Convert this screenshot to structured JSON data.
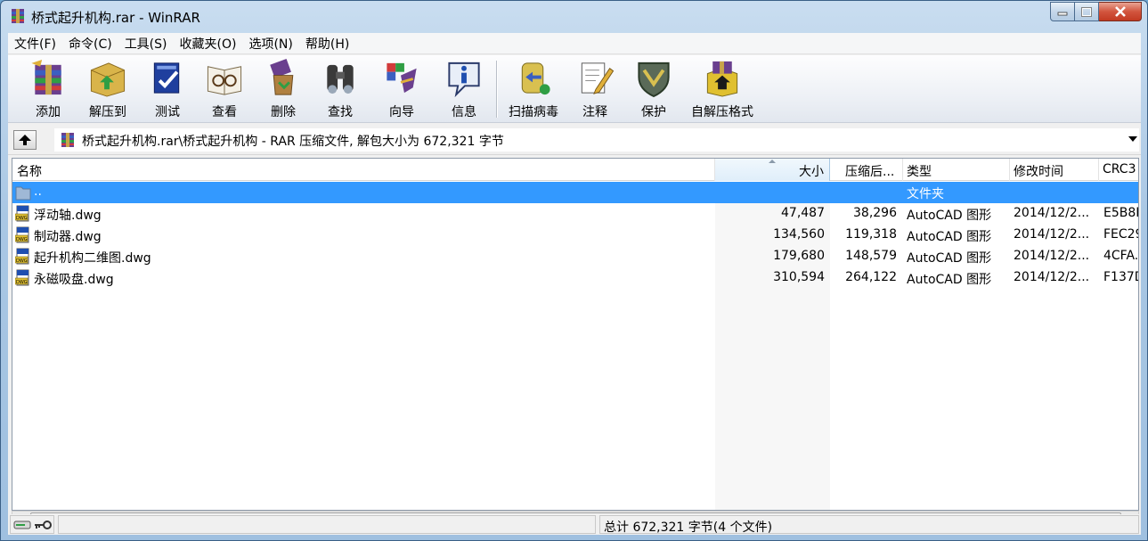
{
  "window": {
    "title": "桥式起升机构.rar - WinRAR",
    "icon": "winrar-archive-icon"
  },
  "menu": [
    "文件(F)",
    "命令(C)",
    "工具(S)",
    "收藏夹(O)",
    "选项(N)",
    "帮助(H)"
  ],
  "toolbar": [
    {
      "label": "添加",
      "icon": "add-icon"
    },
    {
      "label": "解压到",
      "icon": "extract-to-icon"
    },
    {
      "label": "测试",
      "icon": "test-icon"
    },
    {
      "label": "查看",
      "icon": "view-icon"
    },
    {
      "label": "删除",
      "icon": "delete-icon"
    },
    {
      "label": "查找",
      "icon": "find-icon"
    },
    {
      "label": "向导",
      "icon": "wizard-icon"
    },
    {
      "label": "信息",
      "icon": "info-icon"
    },
    {
      "label": "扫描病毒",
      "icon": "virus-scan-icon"
    },
    {
      "label": "注释",
      "icon": "comment-icon"
    },
    {
      "label": "保护",
      "icon": "protect-icon"
    },
    {
      "label": "自解压格式",
      "icon": "sfx-icon"
    }
  ],
  "address": {
    "path": "桥式起升机构.rar\\桥式起升机构 - RAR 压缩文件, 解包大小为 672,321 字节"
  },
  "columns": {
    "name": "名称",
    "size": "大小",
    "packed": "压缩后...",
    "type": "类型",
    "mtime": "修改时间",
    "crc": "CRC3"
  },
  "files": [
    {
      "name": "..",
      "size": "",
      "packed": "",
      "type": "文件夹",
      "mtime": "",
      "crc": "",
      "icon": "folder-icon",
      "selected": true
    },
    {
      "name": "浮动轴.dwg",
      "size": "47,487",
      "packed": "38,296",
      "type": "AutoCAD 图形",
      "mtime": "2014/12/2...",
      "crc": "E5B8E",
      "icon": "dwg-file-icon",
      "selected": false
    },
    {
      "name": "制动器.dwg",
      "size": "134,560",
      "packed": "119,318",
      "type": "AutoCAD 图形",
      "mtime": "2014/12/2...",
      "crc": "FEC29",
      "icon": "dwg-file-icon",
      "selected": false
    },
    {
      "name": "起升机构二维图.dwg",
      "size": "179,680",
      "packed": "148,579",
      "type": "AutoCAD 图形",
      "mtime": "2014/12/2...",
      "crc": "4CFA.",
      "icon": "dwg-file-icon",
      "selected": false
    },
    {
      "name": "永磁吸盘.dwg",
      "size": "310,594",
      "packed": "264,122",
      "type": "AutoCAD 图形",
      "mtime": "2014/12/2...",
      "crc": "F137D",
      "icon": "dwg-file-icon",
      "selected": false
    }
  ],
  "status": {
    "summary": "总计 672,321 字节(4 个文件)"
  },
  "colors": {
    "selection": "#3399ff",
    "titlebar": "#a9c7e4",
    "close": "#c23a22"
  }
}
